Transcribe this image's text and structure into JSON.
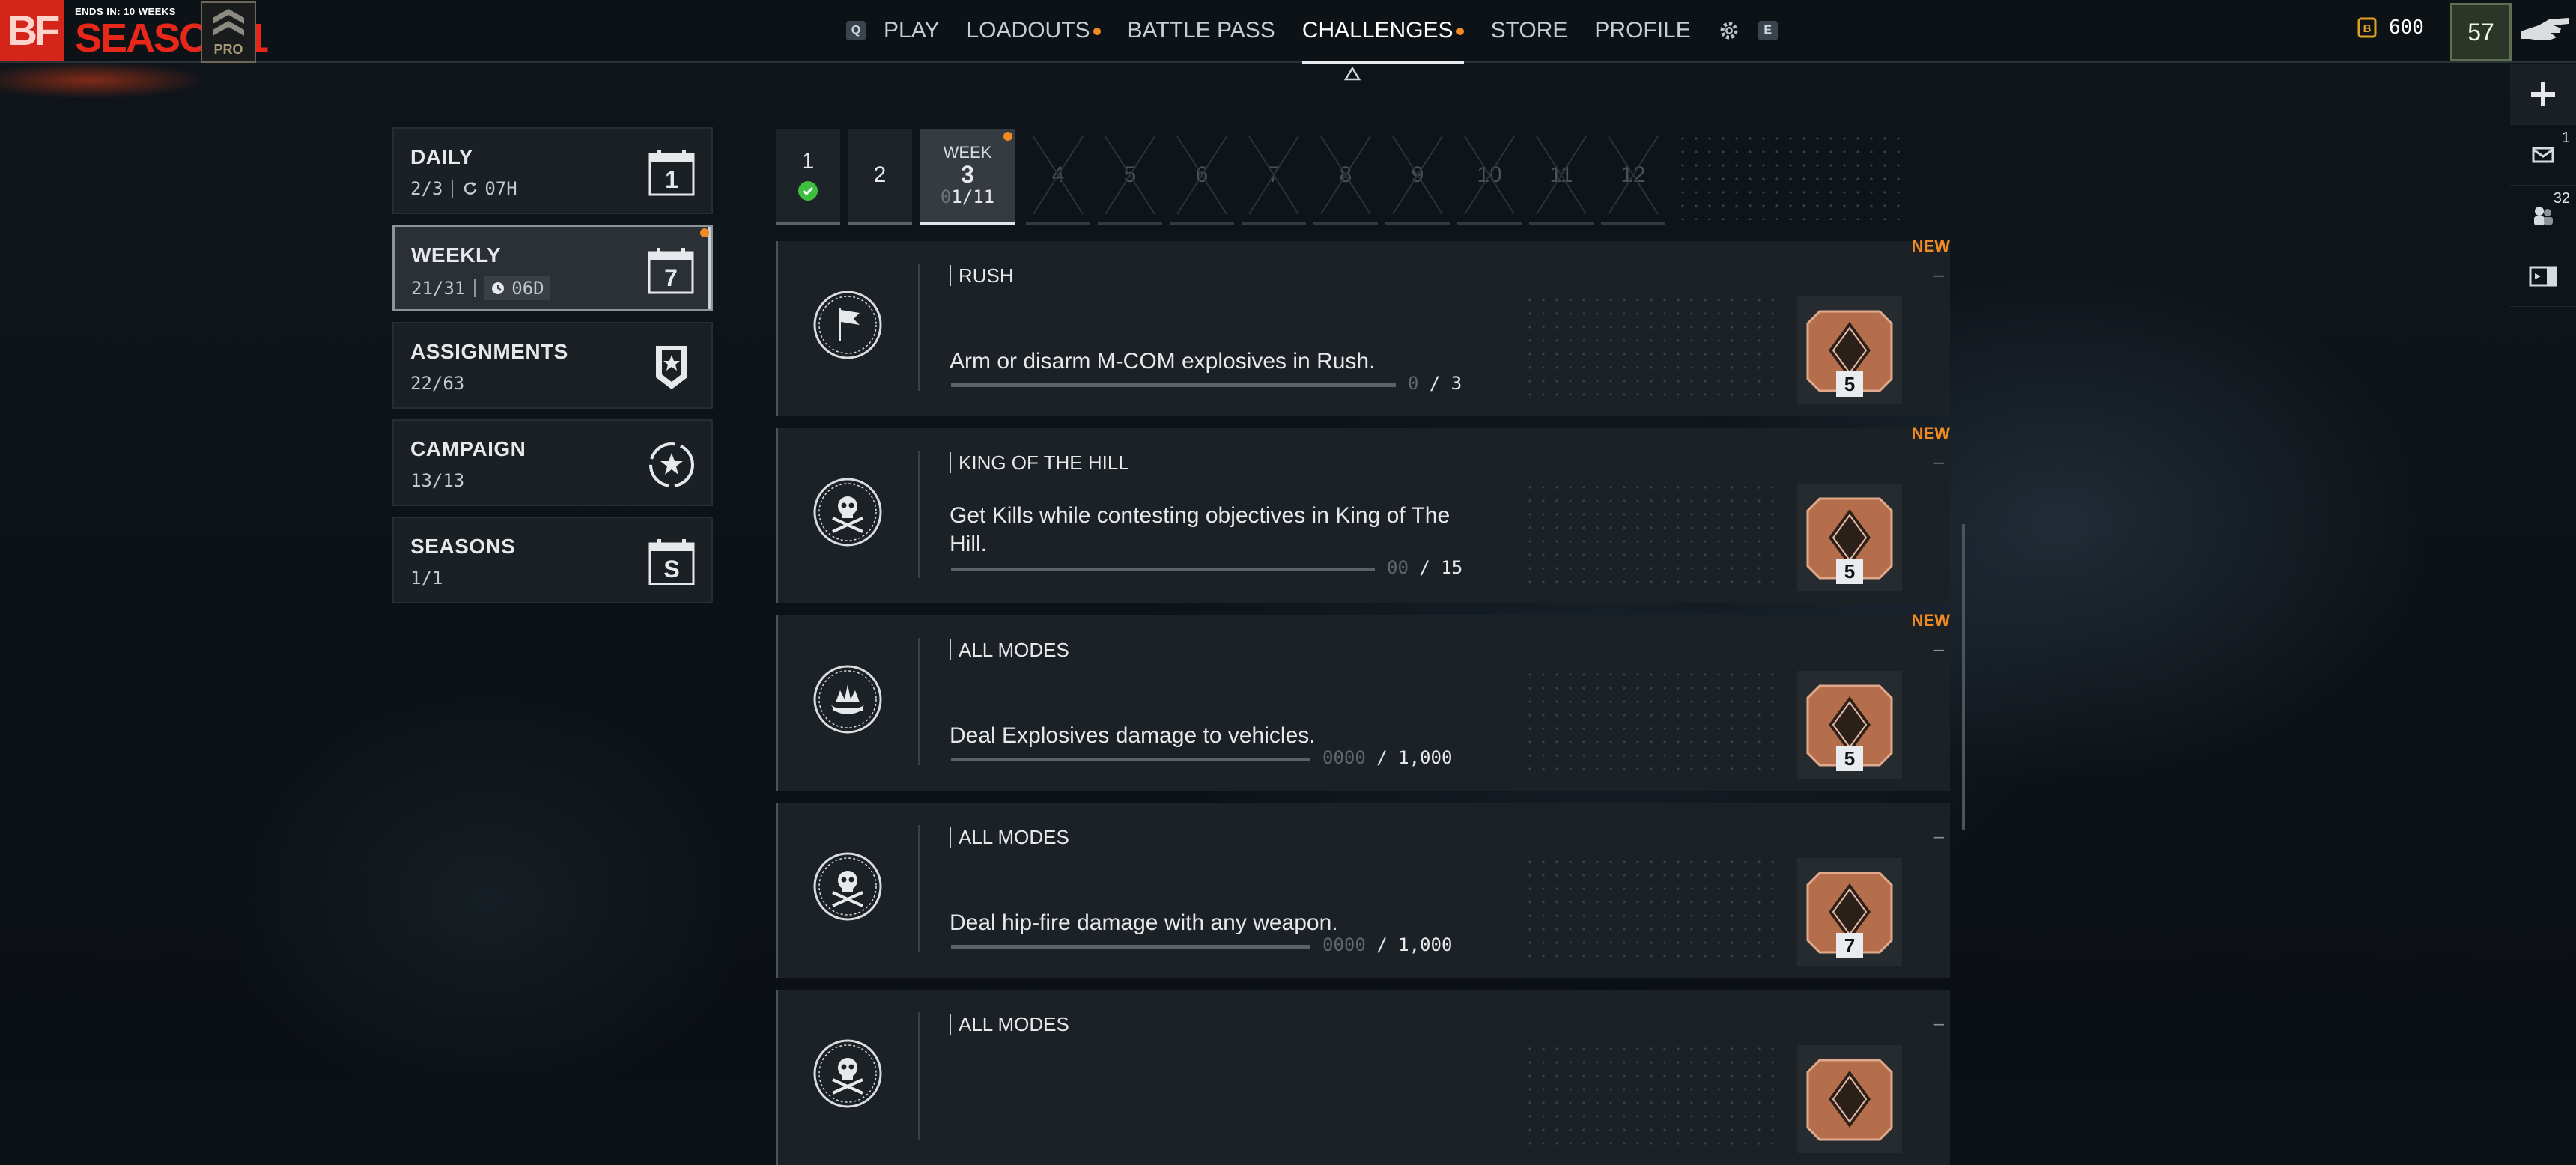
{
  "topbar": {
    "logo": "BF",
    "season_meta": "ENDS IN: 10 WEEKS",
    "season_title": "SEASON 1",
    "pro_label": "PRO",
    "nav_key_left": "Q",
    "nav_key_right": "E",
    "nav": [
      {
        "label": "PLAY",
        "dot": false
      },
      {
        "label": "LOADOUTS",
        "dot": true
      },
      {
        "label": "BATTLE PASS",
        "dot": false
      },
      {
        "label": "CHALLENGES",
        "dot": true,
        "active": true
      },
      {
        "label": "STORE",
        "dot": false
      },
      {
        "label": "PROFILE",
        "dot": false
      }
    ],
    "currency_amount": "600",
    "player_level": "57"
  },
  "right_column": {
    "mail_count": "1",
    "squad_count": "32"
  },
  "categories": [
    {
      "name": "DAILY",
      "progress": "2/3",
      "timer": "07H",
      "icon_label": "1"
    },
    {
      "name": "WEEKLY",
      "progress": "21/31",
      "timer": "06D",
      "icon_label": "7",
      "active": true
    },
    {
      "name": "ASSIGNMENTS",
      "progress": "22/63",
      "icon_label": ""
    },
    {
      "name": "CAMPAIGN",
      "progress": "13/13",
      "icon_label": ""
    },
    {
      "name": "SEASONS",
      "progress": "1/1",
      "icon_label": "S"
    }
  ],
  "weeks": {
    "completed": [
      "1",
      "2"
    ],
    "active": {
      "label": "WEEK",
      "number": "3",
      "progress_ghost": "0",
      "progress": "1/11"
    },
    "locked": [
      "4",
      "5",
      "6",
      "7",
      "8",
      "9",
      "10",
      "11",
      "12"
    ]
  },
  "challenges": [
    {
      "mode": "RUSH",
      "desc": "Arm or disarm M-COM explosives in Rush.",
      "count_ghost": "0",
      "count_rest": " / 3",
      "progress": 0,
      "tier": "5",
      "is_new": true,
      "new_label": "NEW",
      "dash": "–",
      "emblem": "flag-emblem-icon"
    },
    {
      "mode": "KING OF THE HILL",
      "desc": "Get Kills while contesting objectives in King of The Hill.",
      "count_ghost": "00",
      "count_rest": " / 15",
      "progress": 0,
      "tier": "5",
      "is_new": true,
      "new_label": "NEW",
      "dash": "–",
      "emblem": "skull-emblem-icon"
    },
    {
      "mode": "ALL MODES",
      "desc": "Deal Explosives damage to vehicles.",
      "count_ghost": "0000",
      "count_rest": " / 1,000",
      "progress": 0,
      "tier": "5",
      "is_new": true,
      "new_label": "NEW",
      "dash": "–",
      "emblem": "explosion-emblem-icon"
    },
    {
      "mode": "ALL MODES",
      "desc": "Deal hip-fire damage with any weapon.",
      "count_ghost": "0000",
      "count_rest": " / 1,000",
      "progress": 0,
      "tier": "7",
      "is_new": false,
      "dash": "–",
      "emblem": "skull-emblem-icon"
    },
    {
      "mode": "ALL MODES",
      "desc": "",
      "count_ghost": "",
      "count_rest": "",
      "progress": 0,
      "tier": "",
      "is_new": false,
      "dash": "–",
      "emblem": "skull-emblem-icon"
    }
  ],
  "colors": {
    "accent_orange": "#f08a24",
    "brand_red": "#d5251b",
    "panel": "#1c2126"
  }
}
